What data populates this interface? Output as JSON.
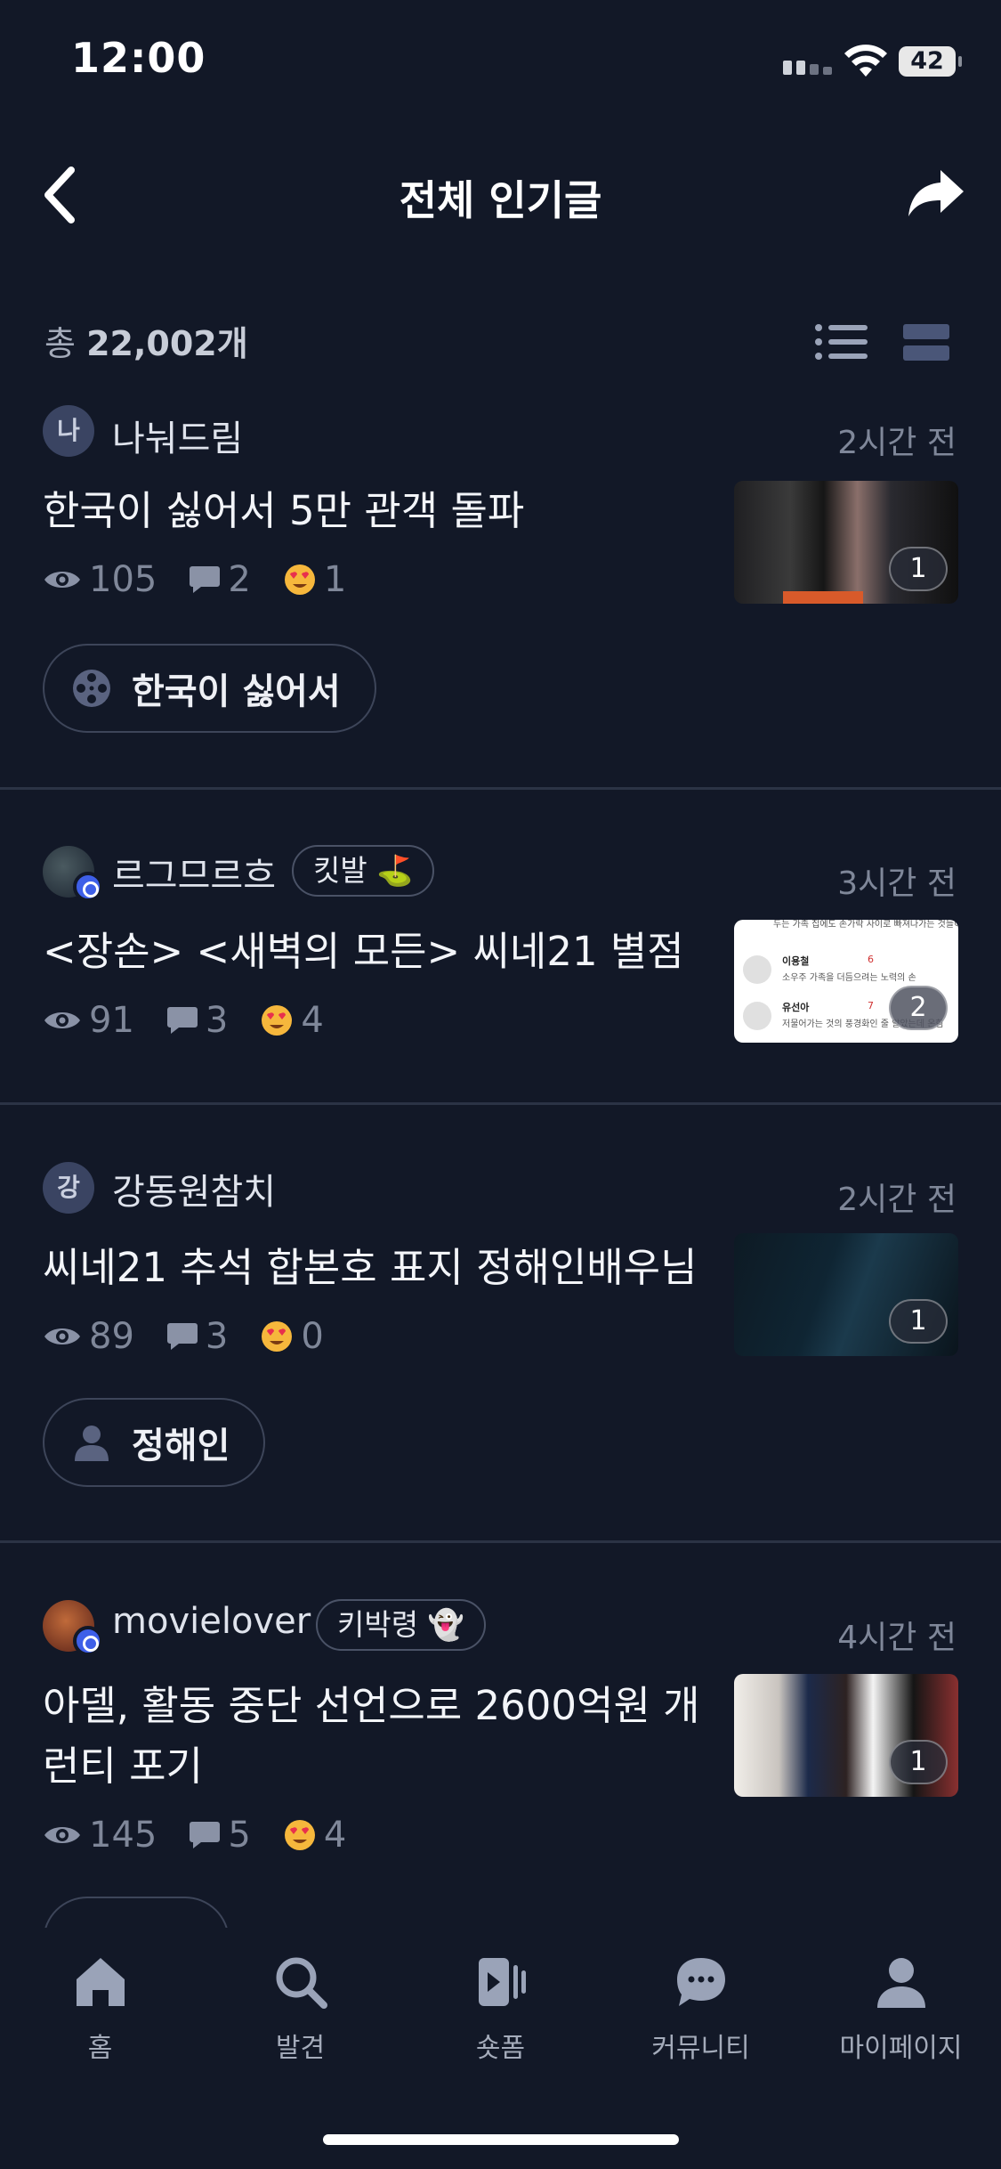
{
  "status": {
    "time": "12:00",
    "battery": "42"
  },
  "header": {
    "title": "전체 인기글"
  },
  "summary": {
    "prefix": "총",
    "count": "22,002개"
  },
  "posts": [
    {
      "avatar_text": "나",
      "author": "나눠드림",
      "time": "2시간 전",
      "title": "한국이 싫어서 5만 관객 돌파",
      "views": "105",
      "comments": "2",
      "reactions": "1",
      "image_count": "1",
      "chip": "한국이 싫어서"
    },
    {
      "author": "르그므르흐",
      "tag": "킷발 ⛳",
      "time": "3시간 전",
      "title": "<장손> <새벽의 모든> 씨네21 별점",
      "views": "91",
      "comments": "3",
      "reactions": "4",
      "image_count": "2",
      "thumb_rows": [
        {
          "name": "",
          "score": "",
          "text": "두는 가족 집에도 손가락 사이로 빠져나가는 것들이 아쉬워서"
        },
        {
          "name": "이용철",
          "score": "6",
          "text": "소우주 가족을 더듬으려는 노력의 손"
        },
        {
          "name": "유선아",
          "score": "7",
          "text": "저물어가는 것의 풍경화인 줄 알았는데 온힘"
        }
      ]
    },
    {
      "avatar_text": "강",
      "author": "강동원참치",
      "time": "2시간 전",
      "title": "씨네21 추석 합본호 표지 정해인배우님",
      "views": "89",
      "comments": "3",
      "reactions": "0",
      "image_count": "1",
      "chip": "정해인"
    },
    {
      "author": "movielover",
      "tag": "키박령 👻",
      "time": "4시간 전",
      "title": "아델, 활동 중단 선언으로 2600억원 개런티 포기",
      "views": "145",
      "comments": "5",
      "reactions": "4",
      "image_count": "1"
    }
  ],
  "tabs": [
    {
      "label": "홈",
      "icon": "home-icon"
    },
    {
      "label": "발견",
      "icon": "search-icon"
    },
    {
      "label": "숏폼",
      "icon": "shortform-icon"
    },
    {
      "label": "커뮤니티",
      "icon": "community-icon"
    },
    {
      "label": "마이페이지",
      "icon": "profile-icon"
    }
  ],
  "colors": {
    "background": "#121827",
    "accent": "#3e5fe8",
    "muted": "#7f8799"
  }
}
